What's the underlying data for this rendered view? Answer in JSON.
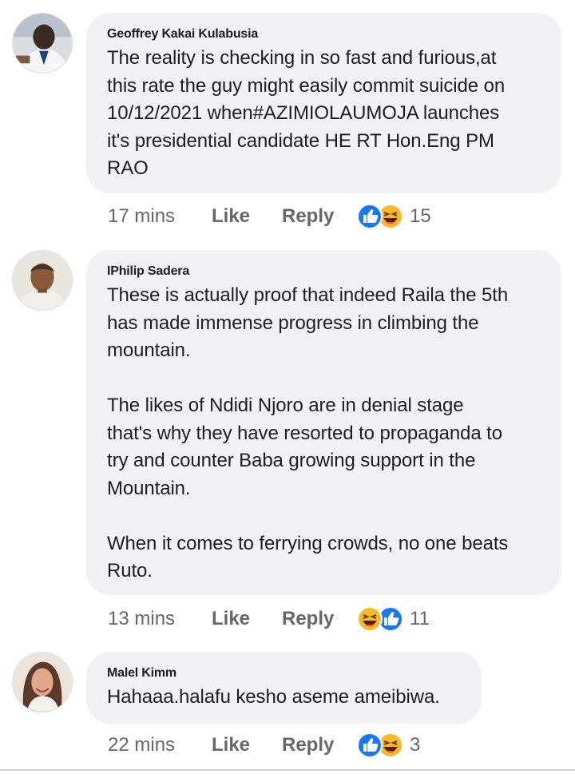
{
  "comments": [
    {
      "author": "Geoffrey Kakai Kulabusia",
      "text": "The reality is checking in so fast and furious,at\nthis rate the guy might easily commit suicide on\n10/12/2021 when#AZIMIOLAUMOJA launches\nit's presidential candidate HE RT Hon.Eng PM\nRAO",
      "time": "17 mins",
      "like_label": "Like",
      "reply_label": "Reply",
      "reactions": [
        "like-icon",
        "haha-icon"
      ],
      "reaction_count": "15"
    },
    {
      "author": "IPhilip Sadera",
      "text": "These is actually proof that indeed Raila the 5th\nhas made immense progress in climbing the\nmountain.\n\nThe likes of Ndidi Njoro are in denial stage\nthat's why they have resorted to propaganda to\ntry and counter Baba growing support in the\nMountain.\n\nWhen it comes to ferrying crowds, no one beats\nRuto.",
      "time": "13 mins",
      "like_label": "Like",
      "reply_label": "Reply",
      "reactions": [
        "haha-icon",
        "like-icon"
      ],
      "reaction_count": "11"
    },
    {
      "author": "Malel Kimm",
      "text": "Hahaaa.halafu kesho aseme ameibiwa.",
      "time": "22 mins",
      "like_label": "Like",
      "reply_label": "Reply",
      "reactions": [
        "like-icon",
        "haha-icon"
      ],
      "reaction_count": "3"
    }
  ],
  "colors": {
    "bubble": "#f0f2f5",
    "like_blue": "#1877f2",
    "haha_yellow": "#f7b928",
    "meta_gray": "#65676b"
  }
}
